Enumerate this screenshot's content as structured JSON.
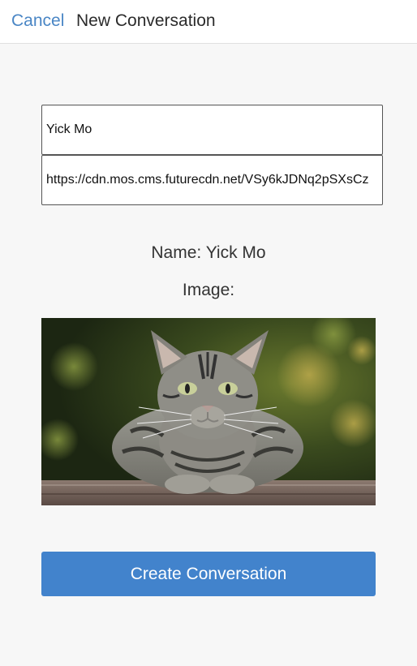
{
  "header": {
    "cancel_label": "Cancel",
    "title": "New Conversation"
  },
  "form": {
    "name_value": "Yick Mo",
    "image_url_value": "https://cdn.mos.cms.futurecdn.net/VSy6kJDNq2pSXsCz"
  },
  "preview": {
    "name_text": "Name: Yick Mo",
    "image_text": "Image:",
    "image_subject": "tabby-cat-photo"
  },
  "actions": {
    "create_label": "Create Conversation"
  },
  "colors": {
    "accent": "#4283cc",
    "link": "#4a86c5",
    "background": "#f7f7f7"
  }
}
